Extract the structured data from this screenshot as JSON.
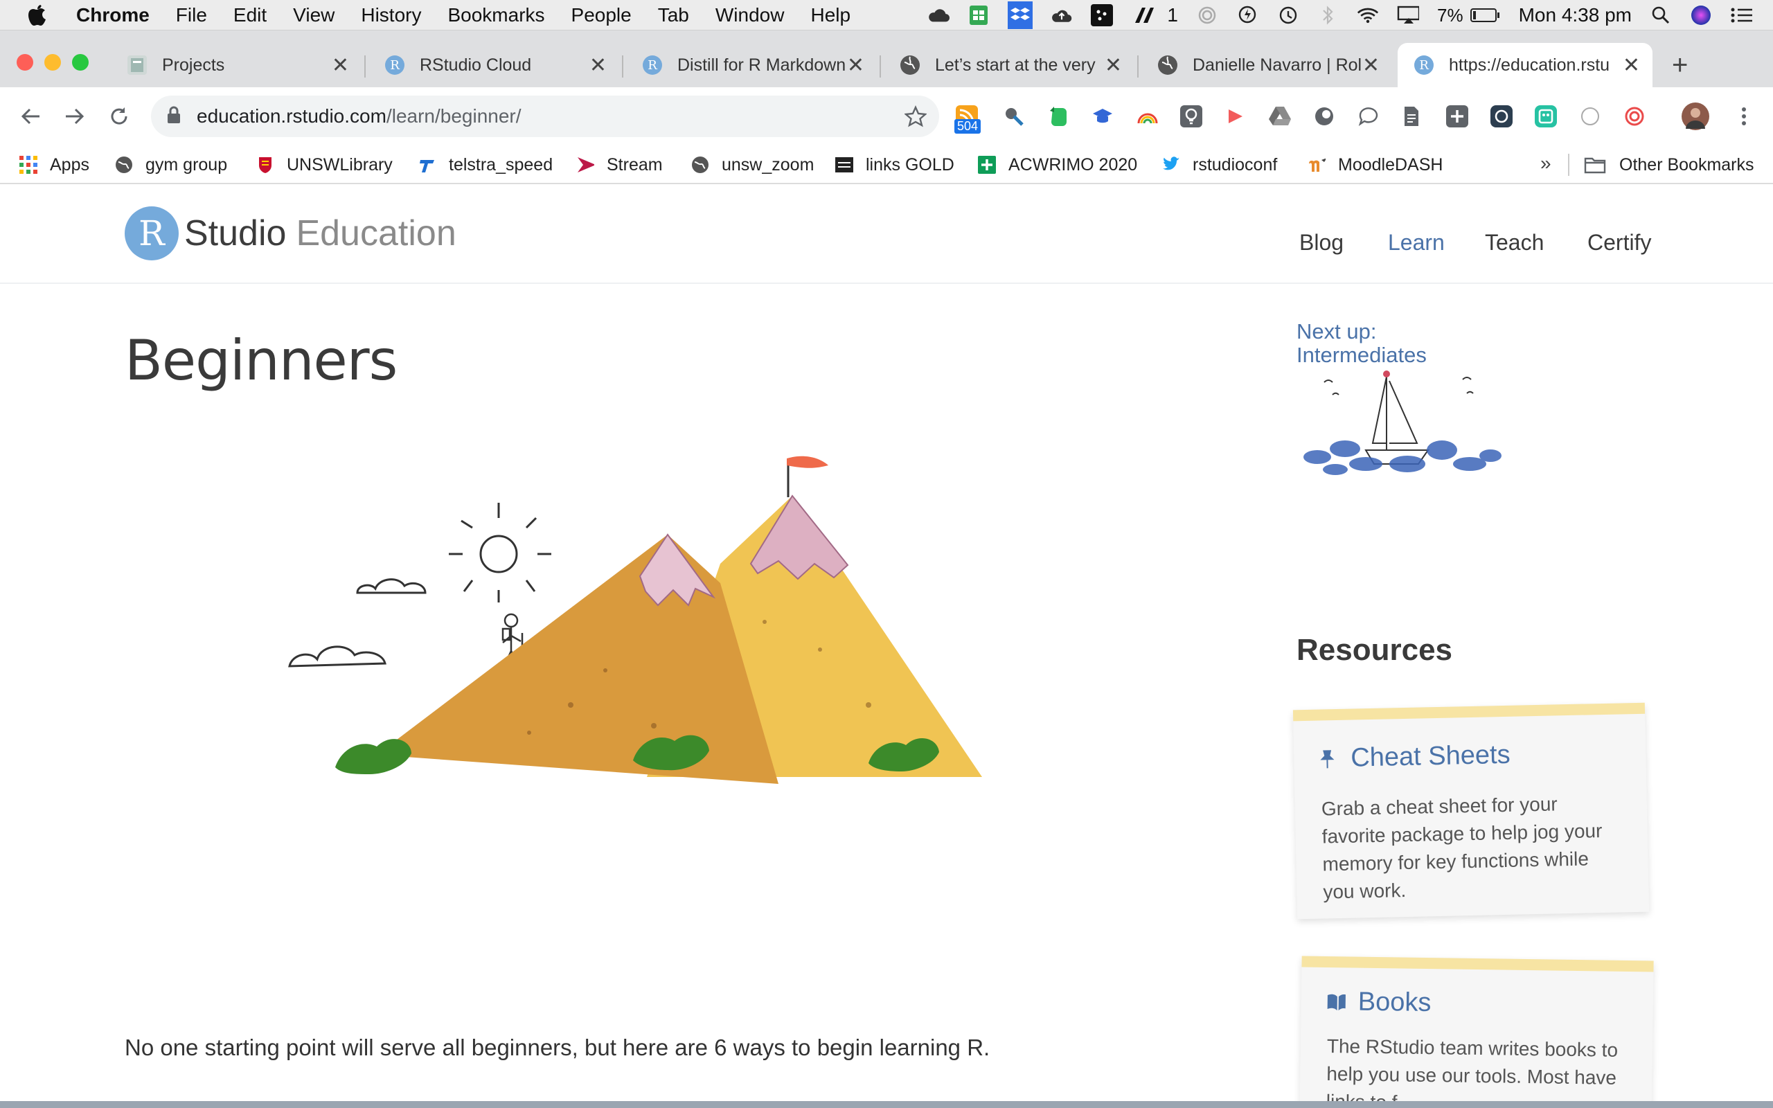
{
  "menubar": {
    "app": "Chrome",
    "items": [
      "File",
      "Edit",
      "View",
      "History",
      "Bookmarks",
      "People",
      "Tab",
      "Window",
      "Help"
    ],
    "status": {
      "notification_count": "1",
      "battery": "7%",
      "clock": "Mon 4:38 pm"
    }
  },
  "tabs": [
    {
      "title": "Projects",
      "favicon": "drive-icon",
      "close": "✕"
    },
    {
      "title": "RStudio Cloud",
      "favicon": "r-icon",
      "close": "✕"
    },
    {
      "title": "Distill for R Markdown",
      "favicon": "r-icon",
      "close": "✕"
    },
    {
      "title": "Let’s start at the very",
      "favicon": "globe-icon",
      "close": "✕"
    },
    {
      "title": "Danielle Navarro | Rol",
      "favicon": "globe-icon",
      "close": "✕"
    },
    {
      "title": "https://education.rstu",
      "favicon": "r-icon",
      "close": "✕",
      "active": true
    }
  ],
  "toolbar": {
    "url_host": "education.rstudio.com",
    "url_path": "/learn/beginner/",
    "rss_badge": "504"
  },
  "bookmarks": {
    "items": [
      "Apps",
      "gym group",
      "UNSWLibrary",
      "telstra_speed",
      "Stream",
      "unsw_zoom",
      "links GOLD",
      "ACWRIMO 2020",
      "rstudioconf",
      "MoodleDASH"
    ],
    "overflow": "»",
    "other": "Other Bookmarks"
  },
  "site": {
    "logo_r": "R",
    "logo_studio": "Studio",
    "logo_education": "Education",
    "nav": [
      "Blog",
      "Learn",
      "Teach",
      "Certify"
    ],
    "active_nav": "Learn"
  },
  "main": {
    "title": "Beginners",
    "lead": "No one starting point will serve all beginners, but here are 6 ways to begin learning R."
  },
  "sidebar": {
    "next_up_line1": "Next up:",
    "next_up_line2": "Intermediates",
    "resources_title": "Resources",
    "cards": [
      {
        "title": "Cheat Sheets",
        "icon": "pushpin-icon",
        "body": [
          "Grab a cheat sheet for your",
          "favorite package to help jog your",
          "memory for key functions while",
          "you work."
        ]
      },
      {
        "title": "Books",
        "icon": "book-icon",
        "body": [
          "The RStudio team writes books to",
          "help you use our tools. Most have",
          "links to f"
        ]
      }
    ]
  },
  "colors": {
    "accent": "#4a72a8",
    "logo_blue": "#75aadb",
    "tape": "#f7e4a3",
    "chrome_tabstrip": "#dedfe1"
  }
}
